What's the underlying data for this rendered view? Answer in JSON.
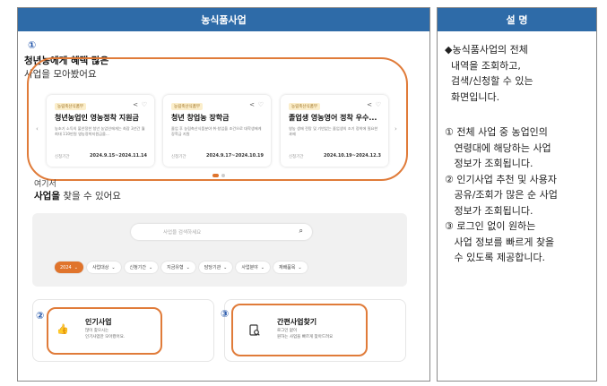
{
  "left_panel": {
    "title": "농식품사업"
  },
  "right_panel": {
    "title": "설  명"
  },
  "markers": {
    "m1": "①",
    "m2": "②",
    "m3": "③"
  },
  "youth": {
    "title": "청년농에게 혜택 많은",
    "subtitle": "사업을 모아봤어요"
  },
  "cards": [
    {
      "tag": "농림축산식품부",
      "title": "청년농업인 영농정착 지원금",
      "desc": "농초기 소득의 불안정한 청년 농업인에게는 최장 3년간 월 최대 110만원 영농정착지원금을...",
      "period_label": "신청기간",
      "period": "2024.9.15~2024.11.14"
    },
    {
      "tag": "농림축산식품부",
      "title": "청년 창업농 장학금",
      "desc": "졸업 후 농림축산식품분야 취·창업을 조건으로 대학생에게 장학금 지원",
      "period_label": "신청기간",
      "period": "2024.9.17~2024.10.19"
    },
    {
      "tag": "농림축산식품부",
      "title": "졸업생 영농영어 정착 우수...",
      "desc": "영농 생애 전망 및 기반없는 졸업생의 조기 정착에 필요한 과제",
      "period_label": "신청기간",
      "period": "2024.10.19~2024.12.3"
    }
  ],
  "icons": {
    "share": "share-icon",
    "heart": "heart-icon",
    "prev": "chevron-left-icon",
    "next": "chevron-right-icon",
    "search": "search-icon",
    "thumb": "thumbs-up-icon",
    "doc": "document-search-icon"
  },
  "here": {
    "line1": "여기서",
    "line2_bold": "사업을",
    "line2_rest": " 찾을 수 있어요"
  },
  "search": {
    "placeholder": "사업을 검색하세요",
    "icon": "⌕"
  },
  "filters": [
    {
      "label": "2024",
      "selected": true
    },
    {
      "label": "사업대상",
      "selected": false
    },
    {
      "label": "신청기간",
      "selected": false
    },
    {
      "label": "지금유형",
      "selected": false
    },
    {
      "label": "담당기관",
      "selected": false
    },
    {
      "label": "사업분야",
      "selected": false
    },
    {
      "label": "재배품목",
      "selected": false
    }
  ],
  "popular": {
    "title": "인기사업",
    "desc1": "많이 찾으시는",
    "desc2": "인기사업만 모아봤어요."
  },
  "quick": {
    "title": "간편사업찾기",
    "desc1": "로그인 없이",
    "desc2": "원하는 사업을 빠르게 찾아드려요"
  },
  "description": {
    "p1": "◆농식품사업의 전체\n  내역을 조회하고,\n  검색/신청할 수 있는\n  화면입니다.",
    "p2": "① 전체 사업 중 농업인의\n   연령대에 해당하는 사업\n   정보가 조회됩니다.\n② 인기사업 추천 및 사용자\n   공유/조회가 많은 순 사업\n   정보가 조회됩니다.\n③ 로그인 없이 원하는\n   사업 정보를 빠르게 찾을\n   수 있도록 제공합니다."
  },
  "colors": {
    "header": "#2e6ba8",
    "accent": "#e0742c",
    "marker": "#2255aa"
  }
}
